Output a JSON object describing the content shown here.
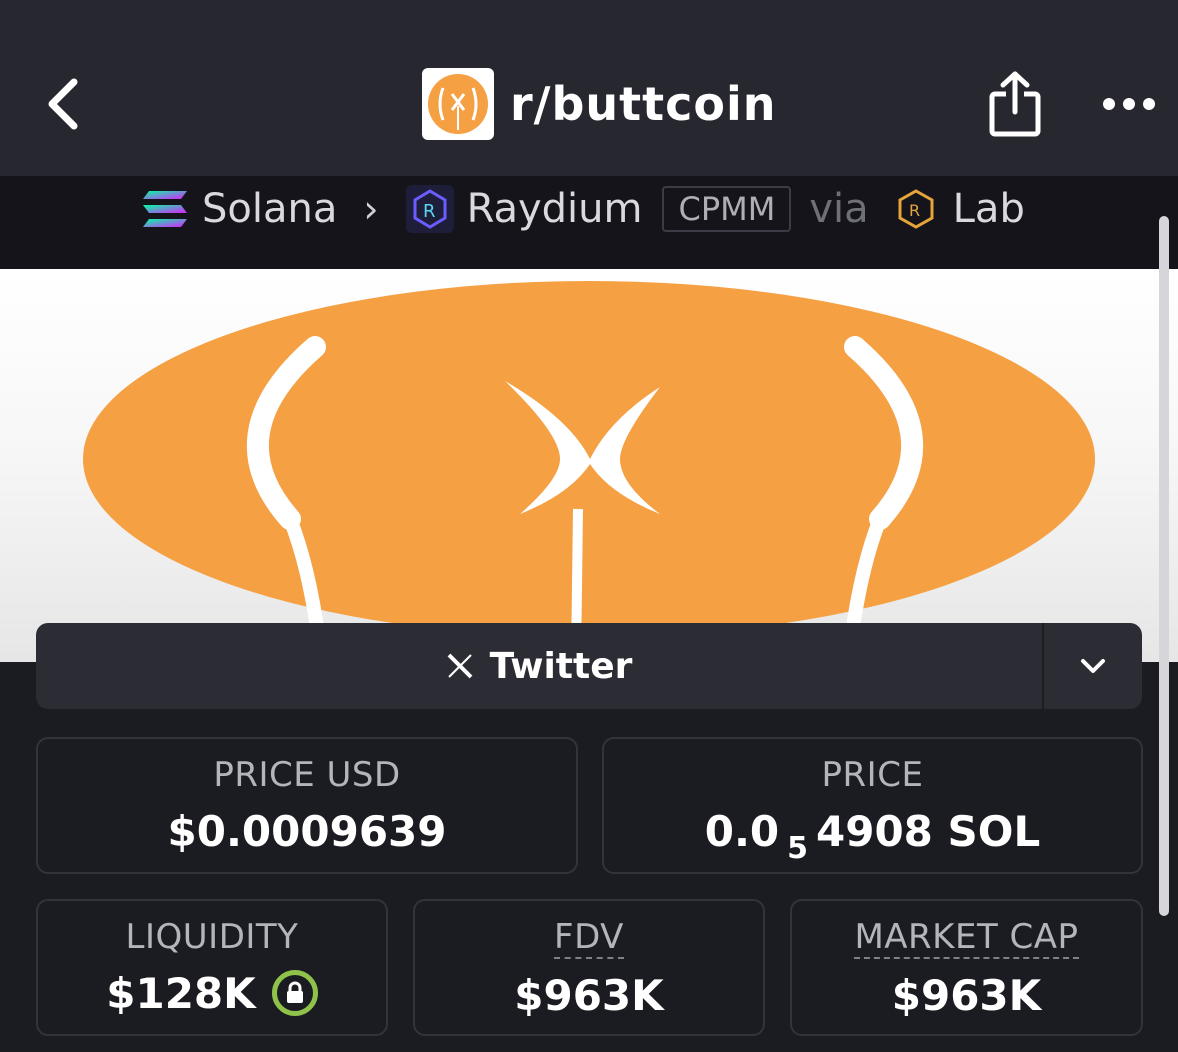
{
  "header": {
    "title": "r/buttcoin",
    "back_icon": "chevron-left-icon",
    "share_icon": "share-icon",
    "more_icon": "more-horizontal-icon"
  },
  "breadcrumb": {
    "chain": "Solana",
    "dex": "Raydium",
    "pool_type": "CPMM",
    "via_label": "via",
    "launchpad": "Lab"
  },
  "links": {
    "twitter_label": "Twitter"
  },
  "stats": {
    "price_usd": {
      "label": "PRICE USD",
      "value": "$0.0009639"
    },
    "price": {
      "label": "PRICE",
      "value_prefix": "0.0",
      "value_zero_count": "5",
      "value_suffix": "4908 SOL"
    },
    "liquidity": {
      "label": "LIQUIDITY",
      "value": "$128K"
    },
    "fdv": {
      "label": "FDV",
      "value": "$963K"
    },
    "market_cap": {
      "label": "MARKET CAP",
      "value": "$963K"
    }
  },
  "colors": {
    "accent_orange": "#f5a043",
    "lock_green": "#8fc24a",
    "background": "#1b1b22"
  }
}
